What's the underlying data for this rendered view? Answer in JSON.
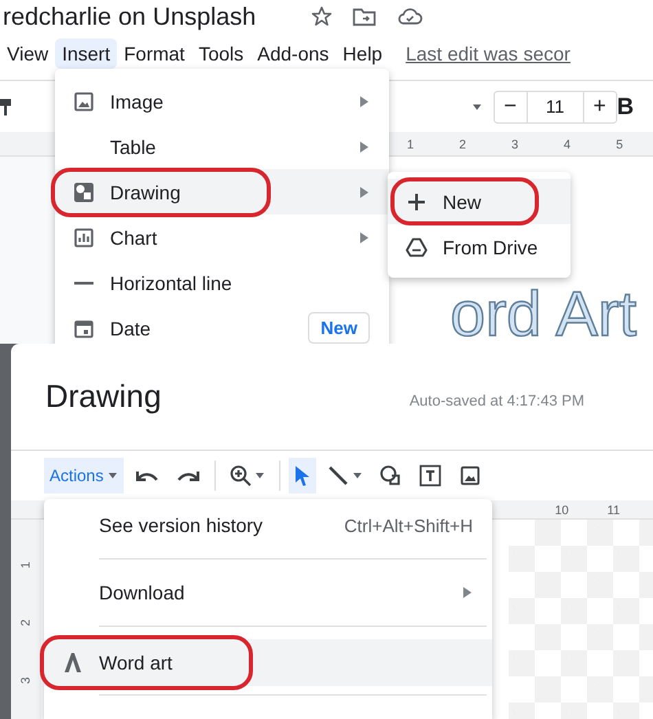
{
  "doc_title": "redcharlie on Unsplash",
  "menu_bar": [
    {
      "label": "View",
      "selected": false
    },
    {
      "label": "Insert",
      "selected": true
    },
    {
      "label": "Format",
      "selected": false
    },
    {
      "label": "Tools",
      "selected": false
    },
    {
      "label": "Add-ons",
      "selected": false
    },
    {
      "label": "Help",
      "selected": false
    }
  ],
  "last_edit": "Last edit was secor",
  "toolbar": {
    "minus": "−",
    "font_size": "11",
    "plus": "+",
    "bold": "B"
  },
  "ruler": [
    "1",
    "2",
    "3",
    "4",
    "5"
  ],
  "document_text": "ord Art",
  "insert_menu": [
    {
      "label": "Image",
      "kind": "image",
      "submenu": true,
      "highlighted": false,
      "marked": false
    },
    {
      "label": "Table",
      "kind": "plain",
      "submenu": true,
      "highlighted": false,
      "marked": false
    },
    {
      "label": "Drawing",
      "kind": "drawing",
      "submenu": true,
      "highlighted": true,
      "marked": true
    },
    {
      "label": "Chart",
      "kind": "chart",
      "submenu": true,
      "highlighted": false,
      "marked": false
    },
    {
      "label": "Horizontal line",
      "kind": "line",
      "submenu": false,
      "highlighted": false,
      "marked": false
    },
    {
      "label": "Date",
      "kind": "calendar",
      "submenu": false,
      "highlighted": false,
      "marked": false,
      "badge": "New"
    }
  ],
  "drawing_submenu": [
    {
      "label": "New",
      "kind": "plus",
      "highlighted": true,
      "marked": true
    },
    {
      "label": "From Drive",
      "kind": "drive",
      "highlighted": false,
      "marked": false
    }
  ],
  "drawing_dialog": {
    "title": "Drawing",
    "autosave": "Auto-saved at 4:17:43 PM",
    "actions": {
      "label": "Actions",
      "selected": true
    },
    "tools": [
      {
        "kind": "undo",
        "selected": false
      },
      {
        "kind": "redo",
        "selected": false
      },
      {
        "kind": "zoom",
        "selected": false
      },
      {
        "kind": "select",
        "selected": true
      },
      {
        "kind": "line",
        "selected": false
      },
      {
        "kind": "shape",
        "selected": false
      },
      {
        "kind": "textbox",
        "selected": false
      },
      {
        "kind": "image",
        "selected": false
      }
    ],
    "ruler": [
      "10",
      "11"
    ],
    "vertical_ruler": [
      "1",
      "2",
      "3"
    ],
    "menu": [
      {
        "label": "See version history",
        "shortcut": "Ctrl+Alt+Shift+H",
        "kind": "plain",
        "submenu": false,
        "highlighted": false,
        "marked": false
      },
      {
        "label": "Download",
        "kind": "plain",
        "submenu": true,
        "highlighted": false,
        "marked": false
      },
      {
        "label": "Word art",
        "kind": "letter",
        "submenu": false,
        "highlighted": true,
        "marked": true
      }
    ]
  }
}
